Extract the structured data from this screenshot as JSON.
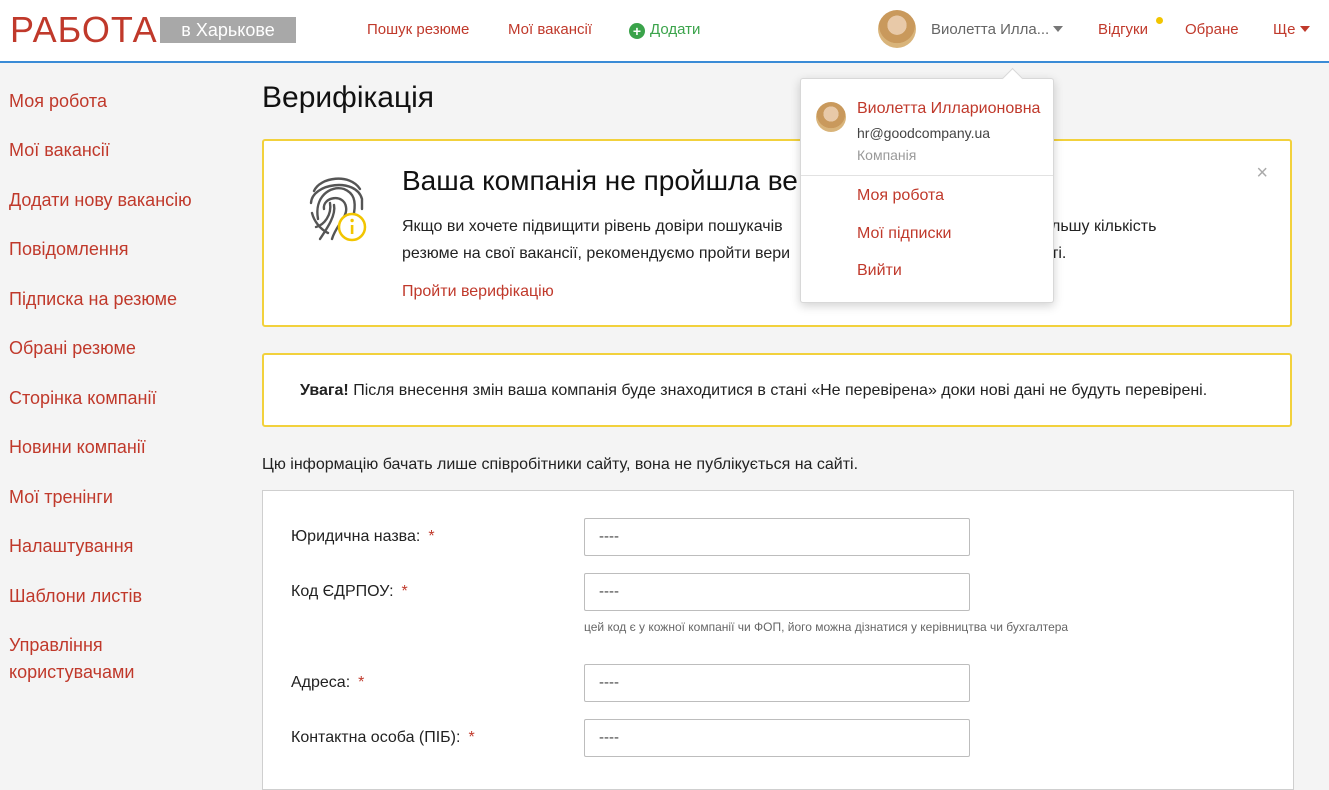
{
  "header": {
    "logo": "РАБОТА",
    "city": "в Харькове",
    "nav": {
      "search_resume": "Пошук резюме",
      "my_vacancies": "Мої вакансії",
      "add": "Додати"
    },
    "user_name": "Виолетта Илла...",
    "responses": "Відгуки",
    "favorites": "Обране",
    "more": "Ще"
  },
  "sidebar": {
    "items": [
      {
        "label": "Моя робота"
      },
      {
        "label": "Мої вакансії"
      },
      {
        "label": "Додати нову вакансію"
      },
      {
        "label": "Повідомлення"
      },
      {
        "label": "Підписка на резюме"
      },
      {
        "label": "Обрані резюме"
      },
      {
        "label": "Сторінка компанії"
      },
      {
        "label": "Новини компанії"
      },
      {
        "label": "Мої тренінги"
      },
      {
        "label": "Налаштування"
      },
      {
        "label": "Шаблони листів"
      },
      {
        "label": "Управління",
        "label2": "користувачами"
      }
    ]
  },
  "main": {
    "title": "Верифікація",
    "verify": {
      "heading": "Ваша компанія не пройшла ве",
      "text_line1": "Якщо ви хочете підвищити рівень довіри пошукачів",
      "text_line1_tail": "льшу кількість",
      "text_line2": "резюме на свої вакансії, рекомендуємо пройти вери",
      "text_line2_tail": "ті.",
      "link": "Пройти верифікацію",
      "close": "×"
    },
    "warning": {
      "bold": "Увага!",
      "text": " Після внесення змін ваша компанія буде знаходитися в стані «Не перевірена» доки нові дані не будуть перевірені."
    },
    "info_note": "Цю інформацію бачать лише співробітники сайту, вона не публікується на сайті.",
    "form": {
      "fields": [
        {
          "label": "Юридична назва:",
          "value": "----"
        },
        {
          "label": "Код ЄДРПОУ:",
          "value": "----",
          "hint": "цей код є у кожної компанії чи ФОП, його можна дізнатися у керівництва чи бухгалтера"
        },
        {
          "label": "Адреса:",
          "value": "----"
        },
        {
          "label": "Контактна особа (ПІБ):",
          "value": "----"
        }
      ],
      "required_mark": "*"
    }
  },
  "dropdown": {
    "name": "Виолетта Илларионовна",
    "email": "hr@goodcompany.ua",
    "role": "Компанія",
    "items": [
      {
        "label": "Моя робота"
      },
      {
        "label": "Мої підписки"
      },
      {
        "label": "Вийти"
      }
    ]
  },
  "colors": {
    "accent": "#c0392b",
    "add_green": "#3aa34a",
    "warning_border": "#f2d13c",
    "header_line": "#3a8bd6"
  }
}
